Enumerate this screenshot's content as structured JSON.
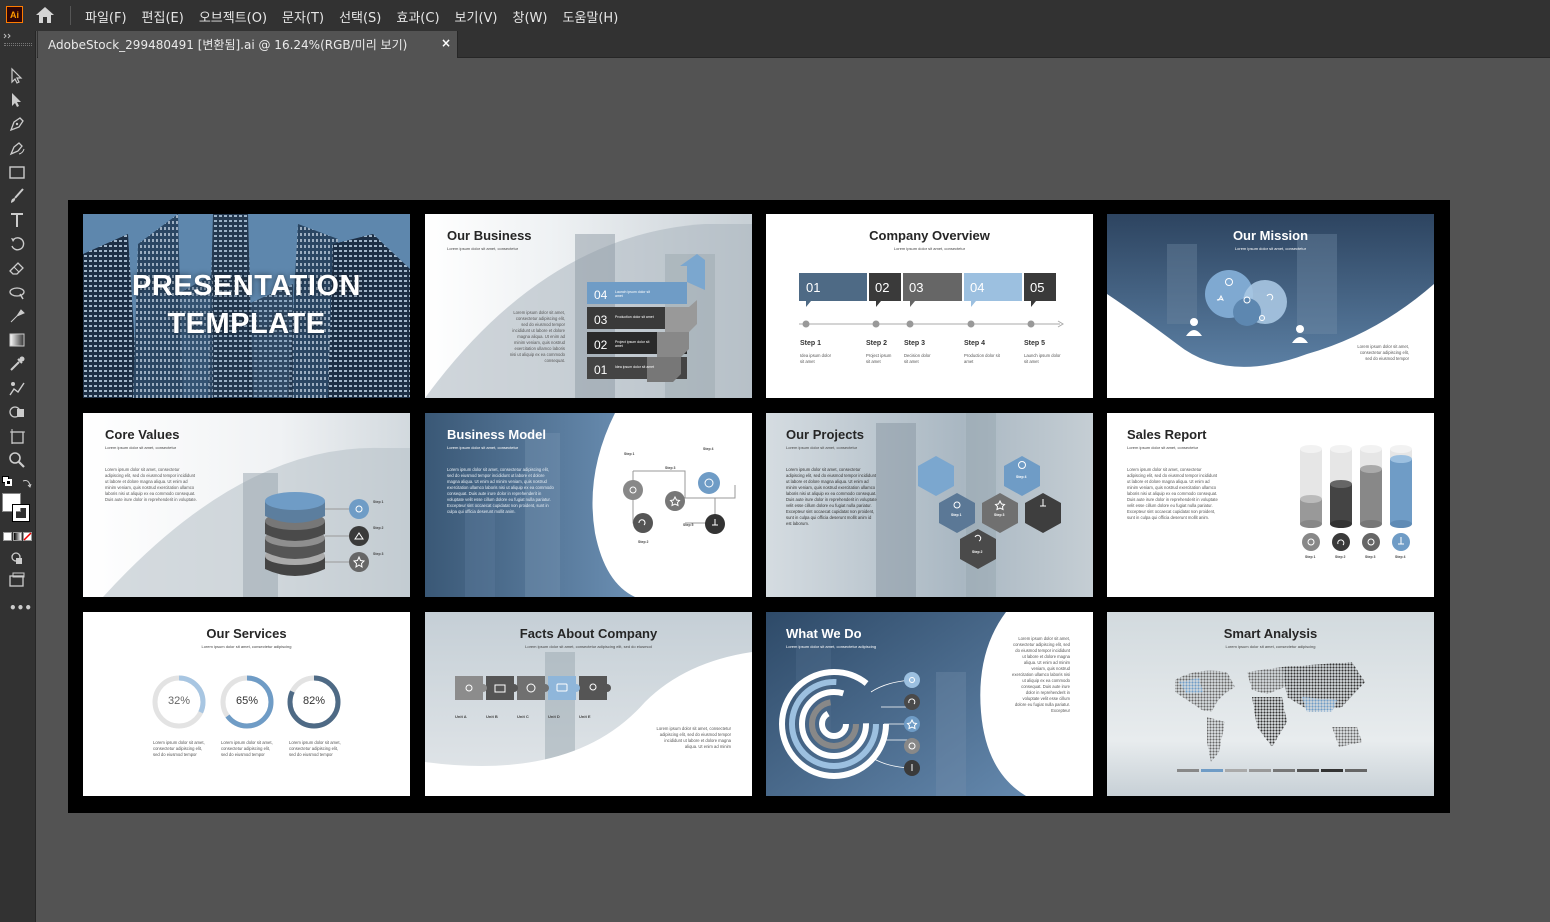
{
  "app": {
    "logo": "Ai"
  },
  "menu": [
    "파일(F)",
    "편집(E)",
    "오브젝트(O)",
    "문자(T)",
    "선택(S)",
    "효과(C)",
    "보기(V)",
    "창(W)",
    "도움말(H)"
  ],
  "tab": {
    "title": "AdobeStock_299480491 [변환됨].ai @ 16.24%(RGB/미리 보기)",
    "close": "×"
  },
  "colors": {
    "accent": "#6f9cc6",
    "dark": "#3a3a3a",
    "chrome": "#323232",
    "canvas": "#535353"
  },
  "tools": [
    "selection-tool-icon",
    "direct-selection-tool-icon",
    "pen-tool-icon",
    "curvature-tool-icon",
    "rectangle-tool-icon",
    "paintbrush-tool-icon",
    "type-tool-icon",
    "rotate-tool-icon",
    "eraser-tool-icon",
    "width-tool-icon",
    "gradient-mesh-tool-icon",
    "gradient-tool-icon",
    "eyedropper-tool-icon",
    "blend-tool-icon",
    "shape-builder-tool-icon",
    "artboard-tool-icon",
    "zoom-tool-icon"
  ],
  "slides": {
    "s1": {
      "title1": "PRESENTATION",
      "title2": "TEMPLATE"
    },
    "s2": {
      "title": "Our Business",
      "sub": "Lorem ipsum dolor sit amet, consectetur",
      "body": "Lorem ipsum dolor sit amet, consectetur adipiscing elit, sed do eiusmod tempor incididunt ut labore et dolore magna aliqua. Ut enim ad minim veniam, quis nostrud exercitation ullamco laboris nisi ut aliquip ex ea commodo consequat.",
      "items": [
        {
          "num": "04",
          "label": "Launch ipsum dolor sit amet"
        },
        {
          "num": "03",
          "label": "Production dolor sit amet"
        },
        {
          "num": "02",
          "label": "Project ipsum dolor sit amet"
        },
        {
          "num": "01",
          "label": "Idea ipsum dolor sit amet"
        }
      ]
    },
    "s3": {
      "title": "Company Overview",
      "sub": "Lorem ipsum dolor sit amet, consectetur",
      "nums": [
        "01",
        "02",
        "03",
        "04",
        "05"
      ],
      "steps": [
        {
          "h": "Step 1",
          "t": "Idea ipsum dolor sit amet"
        },
        {
          "h": "Step 2",
          "t": "Project ipsum sit amet"
        },
        {
          "h": "Step 3",
          "t": "Decision dolor sit amet"
        },
        {
          "h": "Step 4",
          "t": "Production dolor sit amet"
        },
        {
          "h": "Step 5",
          "t": "Launch ipsum dolor sit amet"
        }
      ]
    },
    "s4": {
      "title": "Our Mission",
      "sub": "Lorem ipsum dolor sit amet, consectetur",
      "body": "Lorem ipsum dolor sit amet, consectetur adipiscing elit, sed do eiusmod tempor"
    },
    "s5": {
      "title": "Core Values",
      "sub": "Lorem ipsum dolor sit amet, consectetur",
      "body": "Lorem ipsum dolor sit amet, consectetur adipiscing elit, sed do eiusmod tempor incididunt ut labore et dolore magna aliqua. Ut enim ad minim veniam, quis nostrud exercitation ullamco laboris nisi ut aliquip ex ea commodo consequat. Duis aute irure dolor in reprehenderit in voluptate.",
      "steps": [
        "Step 1",
        "Step 2",
        "Step 3"
      ]
    },
    "s6": {
      "title": "Business Model",
      "sub": "Lorem ipsum dolor sit amet, consectetur",
      "body": "Lorem ipsum dolor sit amet, consectetur adipiscing elit, sed do eiusmod tempor incididunt ut labore et dolore magna aliqua. Ut enim ad minim veniam, quis nostrud exercitation ullamco laboris nisi ut aliquip ex ea commodo consequat. Duis aute irure dolor in reprehenderit in voluptate velit esse cillum dolore eu fugiat nulla pariatur. Excepteur sint occaecat cupidatat non proident, sunt in culpa qui officia deserunt mollit anim.",
      "steps": [
        "Step 1",
        "Step 2",
        "Step 3",
        "Step 4",
        "Step 5"
      ]
    },
    "s7": {
      "title": "Our Projects",
      "sub": "Lorem ipsum dolor sit amet, consectetur",
      "body": "Lorem ipsum dolor sit amet, consectetur adipiscing elit, sed do eiusmod tempor incididunt ut labore et dolore magna aliqua. Ut enim ad minim veniam, quis nostrud exercitation ullamco laboris nisi ut aliquip ex ea commodo consequat. Duis aute irure dolor in reprehenderit in voluptate velit esse cillum dolore eu fugiat nulla pariatur. Excepteur sint occaecat cupidatat non proident, sunt in culpa qui officia deserunt mollit anim id est laborum.",
      "steps": [
        "Step 1",
        "Step 2",
        "Step 3",
        "Step 4"
      ]
    },
    "s8": {
      "title": "Sales Report",
      "sub": "Lorem ipsum dolor sit amet, consectetur",
      "body": "Lorem ipsum dolor sit amet, consectetur adipiscing elit, sed do eiusmod tempor incididunt ut labore et dolore magna aliqua. Ut enim ad minim veniam, quis nostrud exercitation ullamco laboris nisi ut aliquip ex ea commodo consequat. Duis aute irure dolor in reprehenderit in voluptate velit esse cillum dolore eu fugiat nulla pariatur. Excepteur sint occaecat cupidatat non proident, sunt in culpa qui officia deserunt mollit anim.",
      "steps": [
        "Step 1",
        "Step 2",
        "Step 3",
        "Step 4"
      ]
    },
    "s9": {
      "title": "Our Services",
      "sub": "Lorem ipsum dolor sit amet, consectetur adipiscing",
      "pcts": [
        "32%",
        "65%",
        "82%"
      ],
      "pct_values": [
        32,
        65,
        82
      ],
      "cap": "Lorem ipsum dolor sit amet, consectetur adipiscing elit, sed do eiusmod tempor"
    },
    "s10": {
      "title": "Facts About Company",
      "sub": "Lorem ipsum dolor sit amet, consectetur adipiscing elit, sed do eiusmod",
      "units": [
        "Unit A",
        "Unit B",
        "Unit C",
        "Unit D",
        "Unit E"
      ],
      "body": "Lorem ipsum dolor sit amet, consectetur adipiscing elit, sed do eiusmod tempor incididunt ut labore et dolore magna aliqua. Ut enim ad minim"
    },
    "s11": {
      "title": "What We Do",
      "sub": "Lorem ipsum dolor sit amet, consectetur adipiscing",
      "body": "Lorem ipsum dolor sit amet, consectetur adipiscing elit, sed do eiusmod tempor incididunt ut labore et dolore magna aliqua. Ut enim ad minim veniam, quis nostrud exercitation ullamco laboris nisi ut aliquip ex ea commodo consequat. Duis aute irure dolor in reprehenderit in voluptate velit esse cillum dolore eu fugiat nulla pariatur. Excepteur"
    },
    "s12": {
      "title": "Smart Analysis",
      "sub": "Lorem ipsum dolor sit amet, consectetur adipiscing"
    }
  }
}
